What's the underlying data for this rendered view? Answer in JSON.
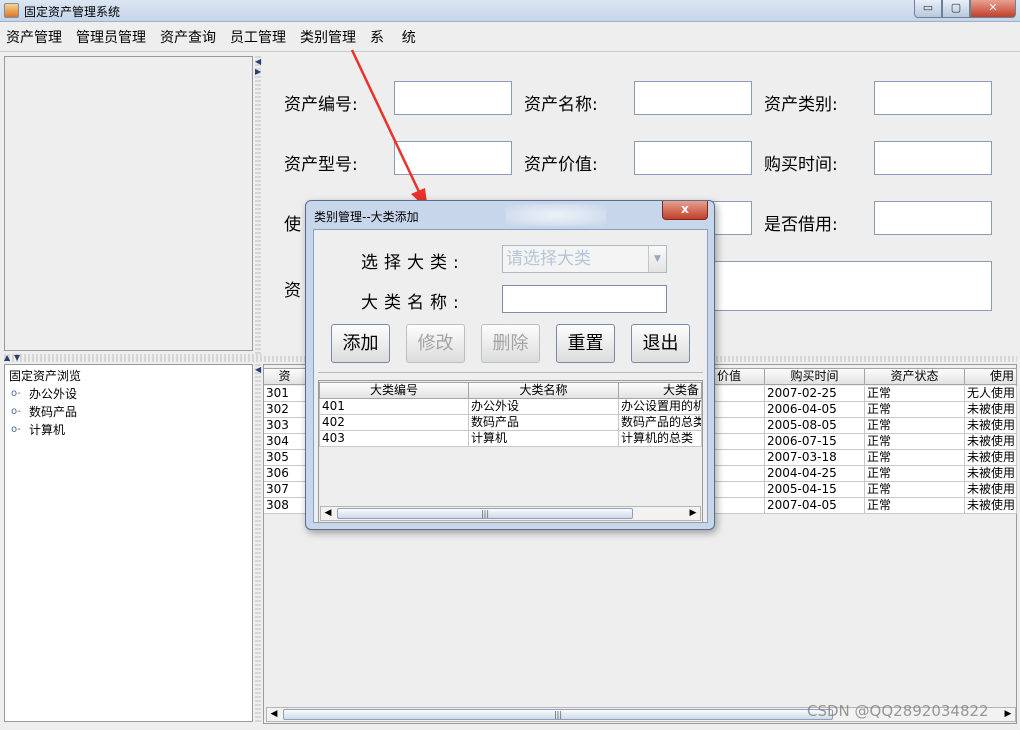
{
  "window": {
    "title": "固定资产管理系统",
    "minimize_glyph": "▭",
    "maximize_glyph": "▢",
    "close_glyph": "✕"
  },
  "menu": [
    "资产管理",
    "管理员管理",
    "资产查询",
    "员工管理",
    "类别管理",
    "系    统"
  ],
  "tree": {
    "root": "固定资产浏览",
    "nodes": [
      "办公外设",
      "数码产品",
      "计算机"
    ],
    "node_icon": "tree-handle-icon"
  },
  "form": {
    "asset_id": "资产编号:",
    "asset_name": "资产名称:",
    "asset_category": "资产类别:",
    "asset_model": "资产型号:",
    "asset_value": "资产价值:",
    "purchase_date": "购买时间:",
    "use_partial": "使",
    "is_borrowed": "是否借用:",
    "remark_partial": "资"
  },
  "main_table": {
    "header_partial_first": "资",
    "header_value": "价值",
    "header_purchase": "购买时间",
    "header_status": "资产状态",
    "header_use": "使用",
    "rows": [
      {
        "id": "301",
        "purchase": "2007-02-25",
        "status": "正常",
        "use": "无人使用"
      },
      {
        "id": "302",
        "purchase": "2006-04-05",
        "status": "正常",
        "use": "未被使用"
      },
      {
        "id": "303",
        "purchase": "2005-08-05",
        "status": "正常",
        "use": "未被使用"
      },
      {
        "id": "304",
        "purchase": "2006-07-15",
        "status": "正常",
        "use": "未被使用"
      },
      {
        "id": "305",
        "purchase": "2007-03-18",
        "status": "正常",
        "use": "未被使用"
      },
      {
        "id": "306",
        "purchase": "2004-04-25",
        "status": "正常",
        "use": "未被使用"
      },
      {
        "id": "307",
        "purchase": "2005-04-15",
        "status": "正常",
        "use": "未被使用"
      },
      {
        "id": "308",
        "purchase": "2007-04-05",
        "status": "正常",
        "use": "未被使用"
      }
    ]
  },
  "dialog": {
    "title": "类别管理--大类添加",
    "close_glyph": "x",
    "select_label": "选择大类:",
    "select_placeholder": "请选择大类",
    "name_label": "大类名称:",
    "buttons": {
      "add": "添加",
      "edit": "修改",
      "delete": "删除",
      "reset": "重置",
      "exit": "退出"
    },
    "table": {
      "headers": [
        "大类编号",
        "大类名称",
        "大类备"
      ],
      "rows": [
        [
          "401",
          "办公外设",
          "办公设置用的机"
        ],
        [
          "402",
          "数码产品",
          "数码产品的总类"
        ],
        [
          "403",
          "计算机",
          "计算机的总类"
        ]
      ]
    }
  },
  "scroll": {
    "left": "◀",
    "right": "▶",
    "grip": "|||"
  },
  "watermark": "CSDN @QQ2892034822",
  "annotation": {
    "arrow_color": "#e8322b"
  }
}
